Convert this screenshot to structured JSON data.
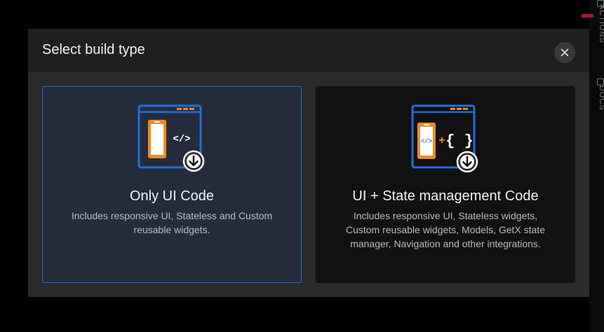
{
  "side_panel": {
    "actions_label": "ACTIONS",
    "docs_label": "DOCS"
  },
  "dialog": {
    "title": "Select build type",
    "close_icon": "close-icon",
    "options": [
      {
        "title": "Only UI Code",
        "description": "Includes responsive UI, Stateless and Custom reusable widgets.",
        "icon": "ui-code-download-illustration",
        "selected": true
      },
      {
        "title": "UI + State management Code",
        "description": "Includes responsive UI, Stateless widgets, Custom reusable widgets, Models, GetX state manager, Navigation and other integrations.",
        "icon": "state-code-download-illustration",
        "selected": false
      }
    ],
    "plus_sign": "+",
    "braces": "{ }",
    "code_tag": "</>"
  },
  "colors": {
    "accent_blue": "#1f6fe0",
    "accent_orange": "#f08a24",
    "selected_card_bg": "#252d3c",
    "card_bg": "#111111"
  }
}
